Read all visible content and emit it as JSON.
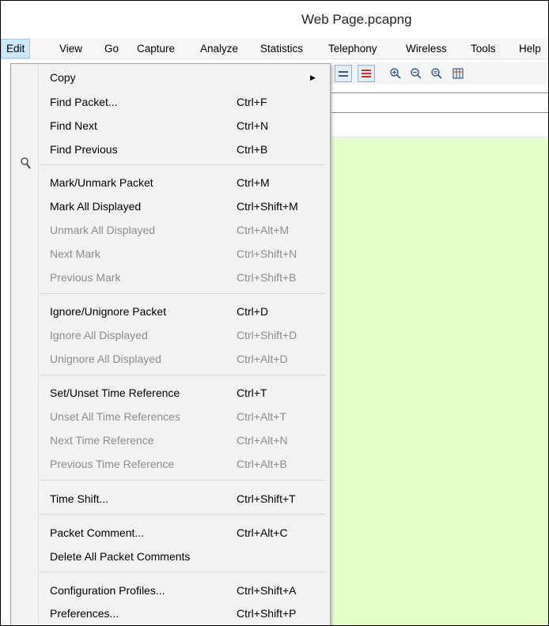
{
  "window": {
    "title": "Web Page.pcapng"
  },
  "menubar": {
    "items": [
      "Edit",
      "View",
      "Go",
      "Capture",
      "Analyze",
      "Statistics",
      "Telephony",
      "Wireless",
      "Tools",
      "Help"
    ],
    "active": "Edit"
  },
  "toolbar": {
    "icons": [
      "colorize-packet-list-icon",
      "autoscroll-icon",
      "zoom-in-icon",
      "zoom-out-icon",
      "normal-size-icon",
      "resize-columns-icon"
    ]
  },
  "edit_menu": {
    "copy": {
      "label": "Copy",
      "shortcut": ""
    },
    "find_packet": {
      "label": "Find Packet...",
      "shortcut": "Ctrl+F"
    },
    "find_next": {
      "label": "Find Next",
      "shortcut": "Ctrl+N"
    },
    "find_previous": {
      "label": "Find Previous",
      "shortcut": "Ctrl+B"
    },
    "mark_unmark": {
      "label": "Mark/Unmark Packet",
      "shortcut": "Ctrl+M"
    },
    "mark_all": {
      "label": "Mark All Displayed",
      "shortcut": "Ctrl+Shift+M"
    },
    "unmark_all": {
      "label": "Unmark All Displayed",
      "shortcut": "Ctrl+Alt+M"
    },
    "next_mark": {
      "label": "Next Mark",
      "shortcut": "Ctrl+Shift+N"
    },
    "previous_mark": {
      "label": "Previous Mark",
      "shortcut": "Ctrl+Shift+B"
    },
    "ignore_unignore": {
      "label": "Ignore/Unignore Packet",
      "shortcut": "Ctrl+D"
    },
    "ignore_all": {
      "label": "Ignore All Displayed",
      "shortcut": "Ctrl+Shift+D"
    },
    "unignore_all": {
      "label": "Unignore All Displayed",
      "shortcut": "Ctrl+Alt+D"
    },
    "set_time_ref": {
      "label": "Set/Unset Time Reference",
      "shortcut": "Ctrl+T"
    },
    "unset_all_time_refs": {
      "label": "Unset All Time References",
      "shortcut": "Ctrl+Alt+T"
    },
    "next_time_ref": {
      "label": "Next Time Reference",
      "shortcut": "Ctrl+Alt+N"
    },
    "previous_time_ref": {
      "label": "Previous Time Reference",
      "shortcut": "Ctrl+Alt+B"
    },
    "time_shift": {
      "label": "Time Shift...",
      "shortcut": "Ctrl+Shift+T"
    },
    "packet_comment": {
      "label": "Packet Comment...",
      "shortcut": "Ctrl+Alt+C"
    },
    "delete_all_comments": {
      "label": "Delete All Packet Comments",
      "shortcut": ""
    },
    "config_profiles": {
      "label": "Configuration Profiles...",
      "shortcut": "Ctrl+Shift+A"
    },
    "preferences": {
      "label": "Preferences...",
      "shortcut": "Ctrl+Shift+P"
    }
  },
  "colors": {
    "packet_list_bg": "#e4ffc7",
    "menu_bg": "#f2f2f2",
    "active_menu_highlight": "#cde8ff",
    "disabled_text": "#8d8d8d"
  }
}
